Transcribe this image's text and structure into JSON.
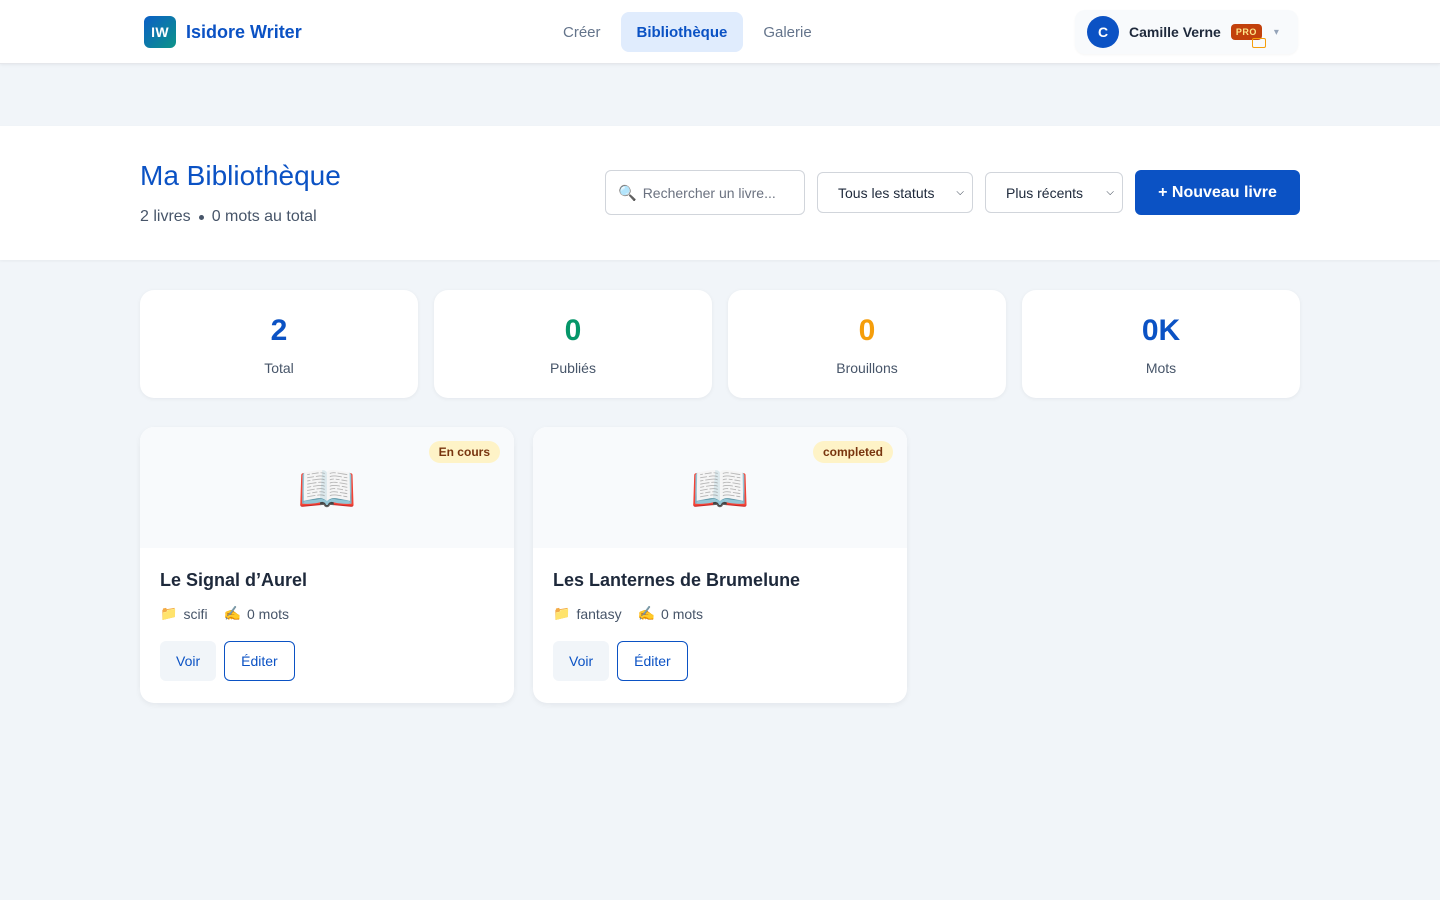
{
  "brand": {
    "logo": "IW",
    "name": "Isidore Writer"
  },
  "nav": {
    "tabs": [
      {
        "label": "Créer"
      },
      {
        "label": "Bibliothèque"
      },
      {
        "label": "Galerie"
      }
    ],
    "active": "Bibliothèque"
  },
  "user": {
    "initial": "C",
    "name": "Camille Verne",
    "badge": "PRO",
    "caret": "▾"
  },
  "header": {
    "title": "Ma Bibliothèque",
    "book_count": "2 livres",
    "word_total": "0 mots au total",
    "search_placeholder": "Rechercher un livre...",
    "status_filter": "Tous les statuts",
    "sort": "Plus récents",
    "new_button": "+ Nouveau livre"
  },
  "stats": [
    {
      "value": "2",
      "label": "Total",
      "color": "#0b52c4"
    },
    {
      "value": "0",
      "label": "Publiés",
      "color": "#059669"
    },
    {
      "value": "0",
      "label": "Brouillons",
      "color": "#f59e0b"
    },
    {
      "value": "0K",
      "label": "Mots",
      "color": "#0b52c4"
    }
  ],
  "books": [
    {
      "title": "Le Signal d’Aurel",
      "status": "En cours",
      "genre": "scifi",
      "words": "0 mots",
      "cover_icon": "open-book-icon",
      "view_label": "Voir",
      "edit_label": "Éditer"
    },
    {
      "title": "Les Lanternes de Brumelune",
      "status": "completed",
      "genre": "fantasy",
      "words": "0 mots",
      "cover_icon": "open-book-icon",
      "view_label": "Voir",
      "edit_label": "Éditer"
    }
  ],
  "icons": {
    "search": "🔍",
    "folder": "📁",
    "writing": "✍️",
    "book": "📖"
  }
}
